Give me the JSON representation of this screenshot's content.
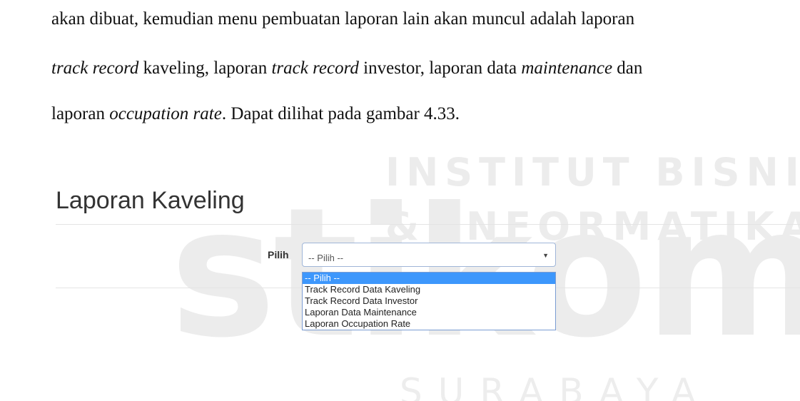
{
  "watermark": {
    "line1": "INSTITUT BISNIS",
    "line2": "& INFORMATIKA",
    "big": "stikom",
    "line3": "SURABAYA"
  },
  "document": {
    "line1": "akan dibuat, kemudian menu pembuatan laporan lain akan muncul adalah laporan",
    "line2_parts": {
      "a": "track record",
      "b": " kaveling, laporan ",
      "c": "track record",
      "d": " investor, laporan data ",
      "e": "maintenance",
      "f": " dan"
    },
    "line3_parts": {
      "a": "laporan ",
      "b": "occupation rate",
      "c": ". Dapat dilihat pada gambar 4.33."
    }
  },
  "screen": {
    "title": "Laporan Kaveling",
    "field_label": "Pilih",
    "select_value": "-- Pilih --",
    "caret": "▼",
    "options": [
      "-- Pilih --",
      "Track Record Data Kaveling",
      "Track Record Data Investor",
      "Laporan Data Maintenance",
      "Laporan Occupation Rate"
    ],
    "selected_index": 0,
    "accent_color": "#3d97fc"
  }
}
